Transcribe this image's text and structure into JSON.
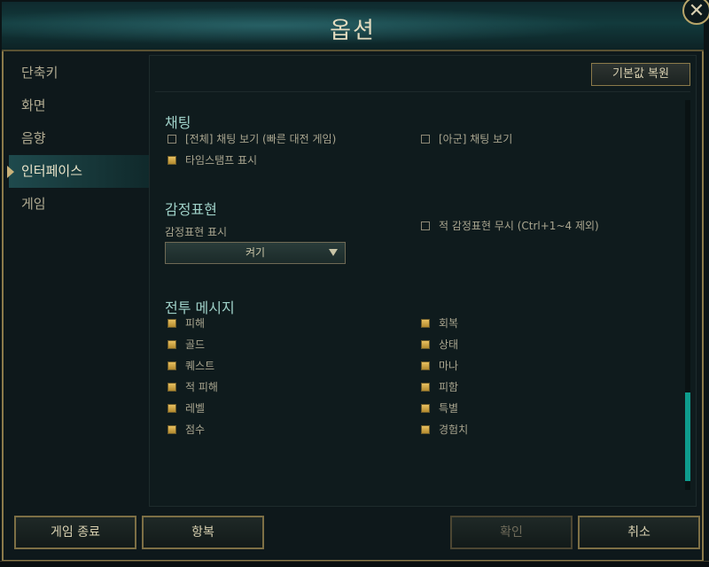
{
  "window": {
    "title": "옵션",
    "close_label": "✕"
  },
  "sidebar": {
    "items": [
      {
        "label": "단축키"
      },
      {
        "label": "화면"
      },
      {
        "label": "음향"
      },
      {
        "label": "인터페이스"
      },
      {
        "label": "게임"
      }
    ],
    "active_index": 3
  },
  "panel": {
    "reset_label": "기본값 복원",
    "chat": {
      "title": "채팅",
      "options": [
        {
          "label": "[전체] 채팅 보기 (빠른 대전 게임)",
          "checked": false
        },
        {
          "label": "[아군] 채팅 보기",
          "checked": false
        },
        {
          "label": "타임스탬프 표시",
          "checked": true
        }
      ]
    },
    "emotes": {
      "title": "감정표현",
      "display_label": "감정표현 표시",
      "display_value": "켜기",
      "ignore_option": {
        "label": "적 감정표현 무시 (Ctrl+1~4 제외)",
        "checked": false
      }
    },
    "combat": {
      "title": "전투 메시지",
      "left": [
        {
          "label": "피해",
          "checked": true
        },
        {
          "label": "골드",
          "checked": true
        },
        {
          "label": "퀘스트",
          "checked": true
        },
        {
          "label": "적 피해",
          "checked": true
        },
        {
          "label": "레벨",
          "checked": true
        },
        {
          "label": "점수",
          "checked": true
        }
      ],
      "right": [
        {
          "label": "회복",
          "checked": true
        },
        {
          "label": "상태",
          "checked": true
        },
        {
          "label": "마나",
          "checked": true
        },
        {
          "label": "피함",
          "checked": true
        },
        {
          "label": "특별",
          "checked": true
        },
        {
          "label": "경험치",
          "checked": true
        }
      ]
    }
  },
  "footer": {
    "quit_label": "게임 종료",
    "surrender_label": "항복",
    "ok_label": "확인",
    "cancel_label": "취소"
  },
  "colors": {
    "accent_gold": "#8b7a4a",
    "checkbox_checked": "#d9aa42",
    "section_title": "#9fd1c8",
    "scroll_thumb": "#0e9c8d"
  }
}
